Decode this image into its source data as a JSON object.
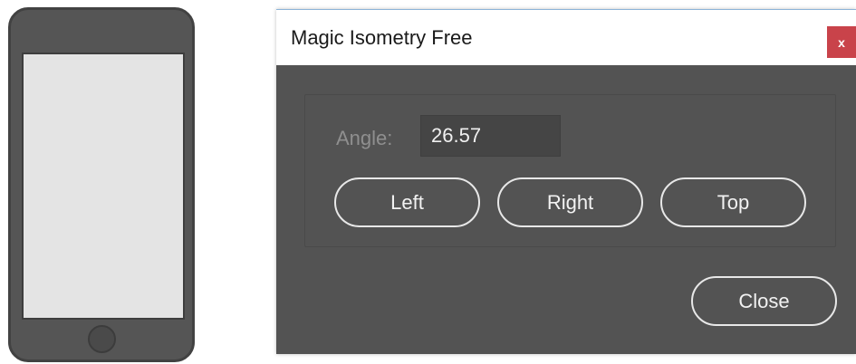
{
  "dialog": {
    "title": "Magic Isometry Free",
    "close_glyph": "x",
    "angle": {
      "label": "Angle:",
      "value": "26.57"
    },
    "buttons": {
      "left": "Left",
      "right": "Right",
      "top": "Top",
      "close": "Close"
    }
  },
  "icons": {
    "window_close": "close-icon",
    "phone": "phone-illustration"
  },
  "colors": {
    "dialog_background": "#535353",
    "close_button": "#c9434a",
    "phone_body": "#555555",
    "phone_screen": "#e4e4e4"
  }
}
